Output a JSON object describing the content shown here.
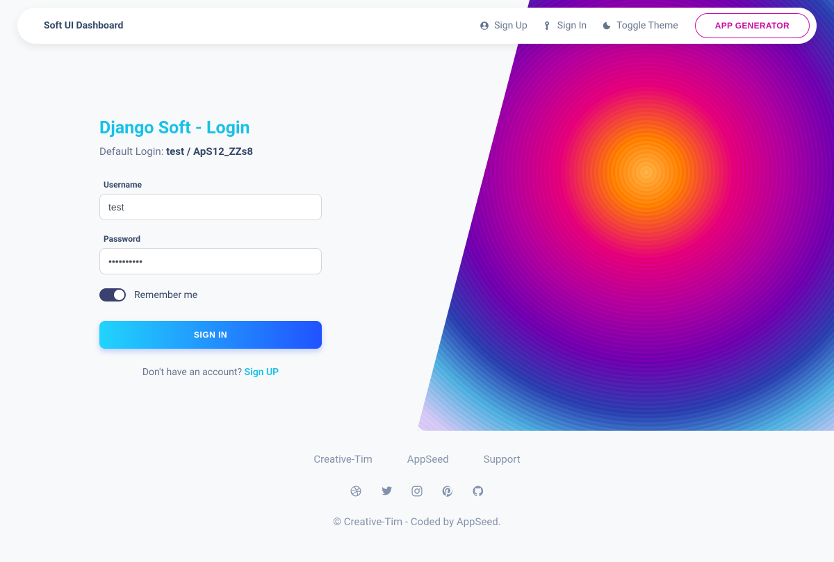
{
  "nav": {
    "brand": "Soft UI Dashboard",
    "signup": "Sign Up",
    "signin": "Sign In",
    "toggle_theme": "Toggle Theme",
    "app_generator": "APP GENERATOR"
  },
  "login": {
    "title": "Django Soft - Login",
    "default_login_prefix": "Default Login: ",
    "default_login_value": "test / ApS12_ZZs8",
    "username_label": "Username",
    "username_value": "test",
    "password_label": "Password",
    "password_value": "••••••••••",
    "remember_label": "Remember me",
    "signin_button": "SIGN IN",
    "no_account_text": "Don't have an account? ",
    "signup_link": "Sign UP"
  },
  "footer": {
    "links": [
      "Creative-Tim",
      "AppSeed",
      "Support"
    ],
    "copyright": "© Creative-Tim - Coded by AppSeed."
  }
}
